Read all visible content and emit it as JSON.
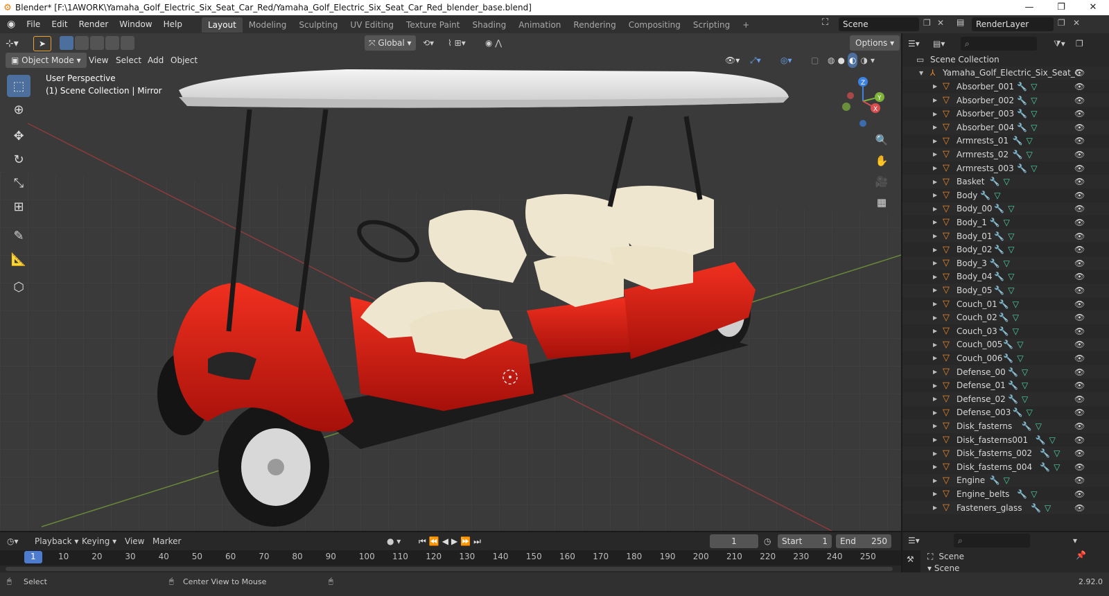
{
  "title_bar": {
    "text": "Blender* [F:\\1AWORK\\Yamaha_Golf_Electric_Six_Seat_Car_Red/Yamaha_Golf_Electric_Six_Seat_Car_Red_blender_base.blend]",
    "minimize": "—",
    "maximize": "❐",
    "close": "✕"
  },
  "menu": [
    "File",
    "Edit",
    "Render",
    "Window",
    "Help"
  ],
  "workspaces": [
    "Layout",
    "Modeling",
    "Sculpting",
    "UV Editing",
    "Texture Paint",
    "Shading",
    "Animation",
    "Rendering",
    "Compositing",
    "Scripting",
    "+"
  ],
  "scene_field": "Scene",
  "renderlayer_field": "RenderLayer",
  "viewport": {
    "mode": "Object Mode",
    "menus": [
      "View",
      "Select",
      "Add",
      "Object"
    ],
    "transform_orientation": "Global",
    "options_label": "Options",
    "overlay_text_1": "User Perspective",
    "overlay_text_2": "(1) Scene Collection | Mirror",
    "gizmo": {
      "x": "X",
      "y": "Y",
      "z": "Z"
    }
  },
  "outliner": {
    "root": "Scene Collection",
    "collection": "Yamaha_Golf_Electric_Six_Seat_C",
    "items": [
      "Absorber_001",
      "Absorber_002",
      "Absorber_003",
      "Absorber_004",
      "Armrests_01",
      "Armrests_02",
      "Armrests_003",
      "Basket",
      "Body",
      "Body_00",
      "Body_1",
      "Body_01",
      "Body_02",
      "Body_3",
      "Body_04",
      "Body_05",
      "Couch_01",
      "Couch_02",
      "Couch_03",
      "Couch_005",
      "Couch_006",
      "Defense_00",
      "Defense_01",
      "Defense_02",
      "Defense_003",
      "Disk_fasterns",
      "Disk_fasterns001",
      "Disk_fasterns_002",
      "Disk_fasterns_004",
      "Engine",
      "Engine_belts",
      "Fasteners_glass"
    ]
  },
  "timeline": {
    "menus": [
      "Playback",
      "Keying",
      "View",
      "Marker"
    ],
    "current_frame": "1",
    "start_label": "Start",
    "start_value": "1",
    "end_label": "End",
    "end_value": "250",
    "ruler": [
      "1",
      "10",
      "20",
      "30",
      "40",
      "50",
      "60",
      "70",
      "80",
      "90",
      "100",
      "110",
      "120",
      "130",
      "140",
      "150",
      "160",
      "170",
      "180",
      "190",
      "200",
      "210",
      "220",
      "230",
      "240",
      "250"
    ]
  },
  "properties": {
    "scene_label": "Scene",
    "section_label": "Scene"
  },
  "statusbar": {
    "select": "Select",
    "center_view": "Center View to Mouse",
    "version": "2.92.0"
  },
  "colors": {
    "accent": "#4d6f9e",
    "car_body": "#d41b13",
    "seat": "#efe6cf",
    "object_icon": "#e8882a"
  }
}
